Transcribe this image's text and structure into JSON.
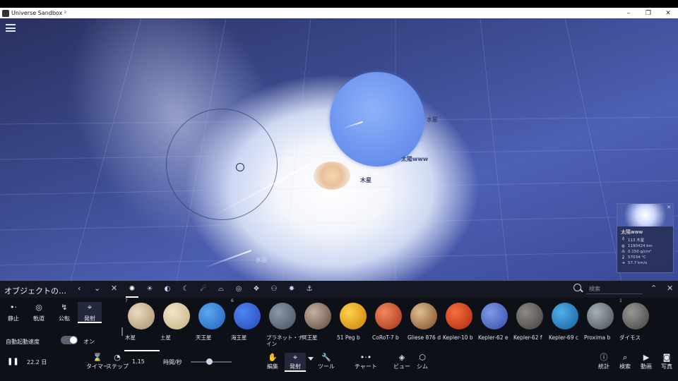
{
  "window": {
    "title": "Universe Sandbox ²",
    "minimize": "–",
    "maximize": "❐",
    "close": "✕"
  },
  "viewport": {
    "labels": {
      "neptune_label": "水星",
      "sun_label": "太陽www",
      "jupiter_label": "木星",
      "mercury_label": "水星"
    }
  },
  "info_card": {
    "close": "✕",
    "name": "太陽www",
    "rows": [
      {
        "icon": "♁",
        "text": "113 木星"
      },
      {
        "icon": "◍",
        "text": "1190424 km"
      },
      {
        "icon": "⁂",
        "text": "0.150 g/cm³"
      },
      {
        "icon": "🌡",
        "text": "57034 °C"
      },
      {
        "icon": "➜",
        "text": "57.7 km/s"
      }
    ]
  },
  "panel": {
    "title": "オブジェクトの…",
    "prev": "‹",
    "collapse": "⌄",
    "close_filter": "✕",
    "search_placeholder": "検索",
    "expand": "⌃",
    "close": "✕",
    "modes": [
      {
        "icon": "•·",
        "label": "静止"
      },
      {
        "icon": "◎",
        "label": "軌道"
      },
      {
        "icon": "↯",
        "label": "公転"
      },
      {
        "icon": "⌖",
        "label": "発射"
      }
    ],
    "auto_launch": "自動起動速度",
    "toggle_state": "オン",
    "objects": [
      {
        "name": "木星",
        "count": "7",
        "c1": "#e8dcc4",
        "c2": "#b59a76"
      },
      {
        "name": "土星",
        "count": "",
        "c1": "#f1e6c9",
        "c2": "#cbb889"
      },
      {
        "name": "天王星",
        "count": "",
        "c1": "#5aa7f0",
        "c2": "#2a6cc4"
      },
      {
        "name": "海王星",
        "count": "6",
        "c1": "#4f86f2",
        "c2": "#2a52c0"
      },
      {
        "name": "プラネット・ナイン",
        "count": "",
        "c1": "#8a9aaa",
        "c2": "#4c5866"
      },
      {
        "name": "冥王星",
        "count": "",
        "c1": "#c4b0a0",
        "c2": "#6a5448"
      },
      {
        "name": "51 Peg b",
        "count": "",
        "c1": "#ffd34a",
        "c2": "#d08a10"
      },
      {
        "name": "CoRoT-7 b",
        "count": "",
        "c1": "#f08a5a",
        "c2": "#b03c24"
      },
      {
        "name": "Gliese 876 d",
        "count": "",
        "c1": "#e0c090",
        "c2": "#8a5a30"
      },
      {
        "name": "Kepler-10 b",
        "count": "",
        "c1": "#f5703a",
        "c2": "#b8301a"
      },
      {
        "name": "Kepler-62 e",
        "count": "",
        "c1": "#7f9ae8",
        "c2": "#3e58b0"
      },
      {
        "name": "Kepler-62 f",
        "count": "",
        "c1": "#8e8a84",
        "c2": "#4c4a46"
      },
      {
        "name": "Kepler-69 c",
        "count": "",
        "c1": "#4fb0e8",
        "c2": "#1e6aa8"
      },
      {
        "name": "Proxima b",
        "count": "",
        "c1": "#a8aeb6",
        "c2": "#555b62"
      },
      {
        "name": "ダイモス",
        "count": "1",
        "c1": "#9a9896",
        "c2": "#4e4c4a"
      }
    ]
  },
  "toolbar": {
    "play": "❚❚",
    "time": "22.2 日",
    "timer_label": "タイマー",
    "step_label": "ステップ",
    "speed_value": "1.15",
    "speed_unit": "時間/秒",
    "center_tools": [
      {
        "icon": "✋",
        "label": "編集"
      },
      {
        "icon": "⌖",
        "label": "発射"
      },
      {
        "icon": "🔧",
        "label": "ツール"
      },
      {
        "icon": "•·•",
        "label": "チャート"
      },
      {
        "icon": "◈",
        "label": "ビュー"
      },
      {
        "icon": "⬡",
        "label": "シム"
      }
    ],
    "right_tools": [
      {
        "icon": "ⓘ",
        "label": "統計"
      },
      {
        "icon": "⌕",
        "label": "検索"
      },
      {
        "icon": "▶",
        "label": "動画"
      },
      {
        "icon": "◙",
        "label": "写真"
      }
    ]
  }
}
